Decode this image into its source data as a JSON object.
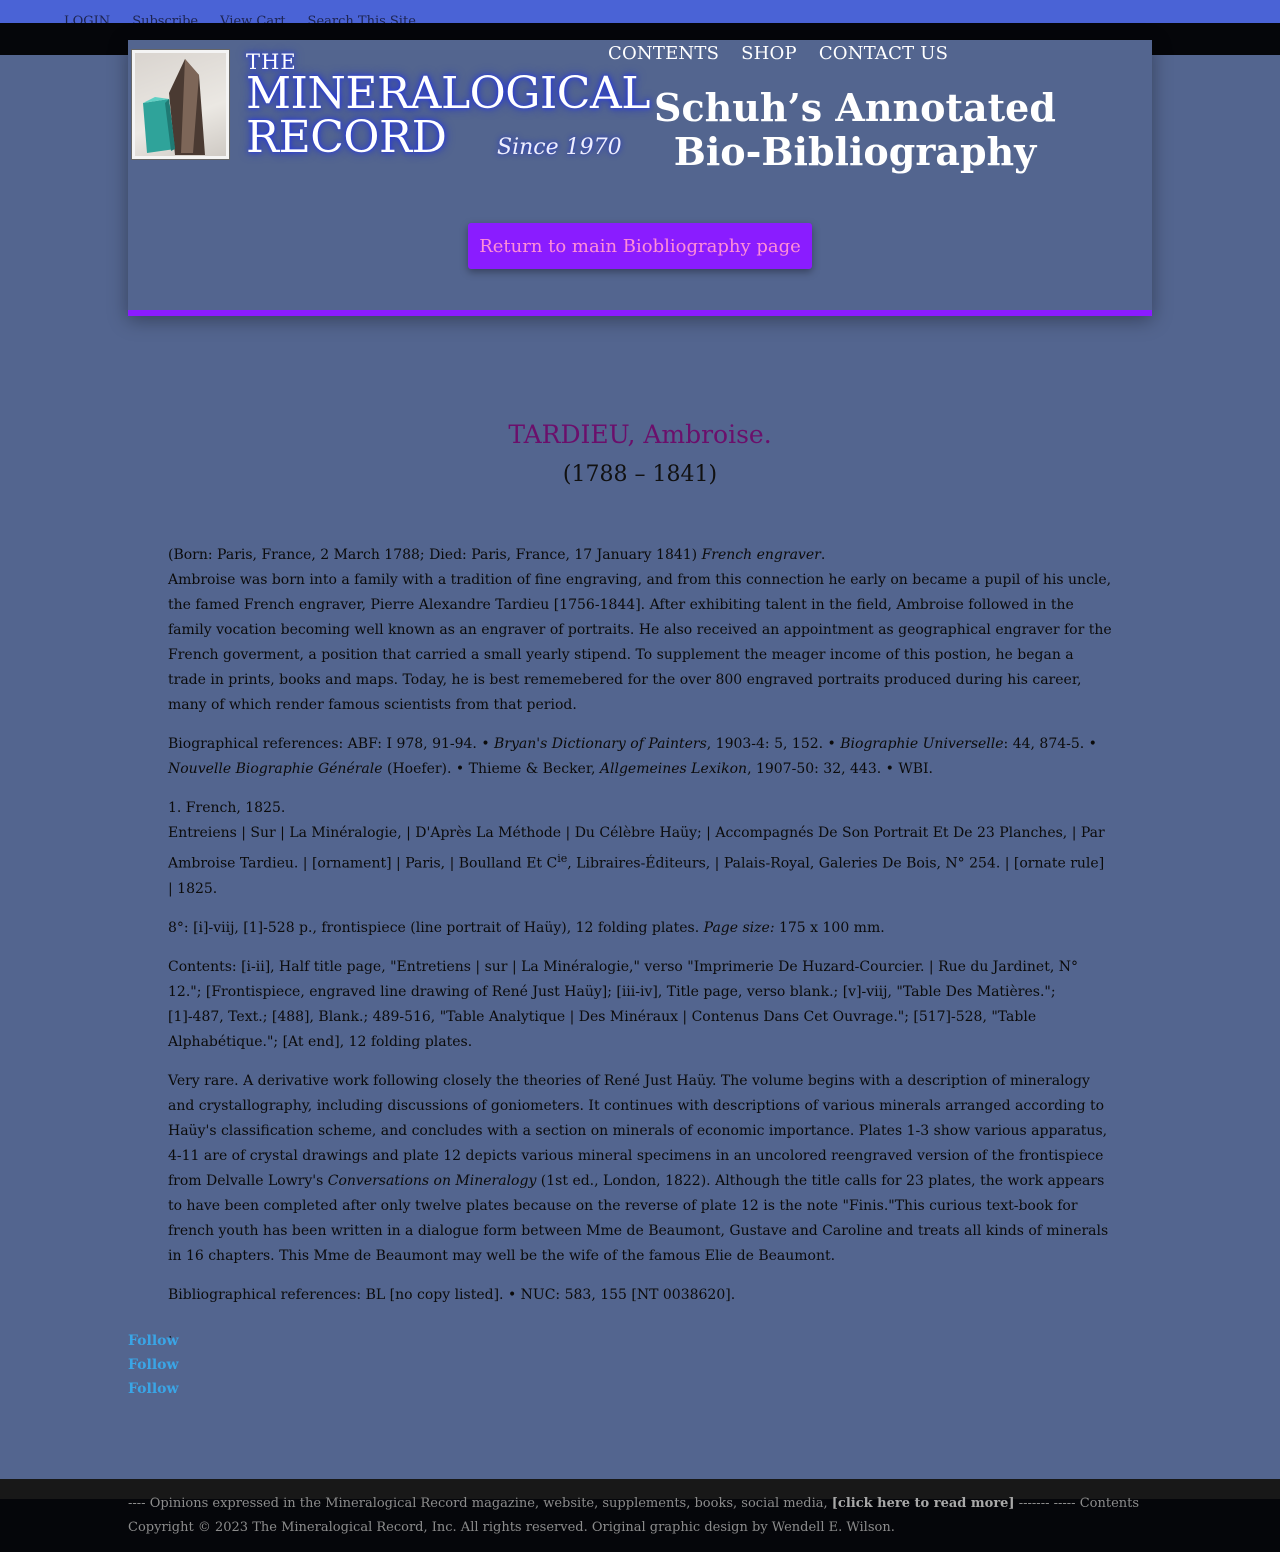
{
  "top_links": [
    "LOGIN",
    "Subscribe",
    "View Cart",
    "Search This Site"
  ],
  "nav": [
    "CONTENTS",
    "SHOP",
    "CONTACT US"
  ],
  "logo": {
    "the": "THE",
    "line1": "MINERALOGICAL",
    "line2": "RECORD",
    "since": "Since 1970"
  },
  "page_title": "Schuh’s Annotated Bio-Bibliography",
  "return_button": "Return to main Biobliography page",
  "entry": {
    "name": "TARDIEU, Ambroise.",
    "dates": "(1788 – 1841)",
    "born_line": "(Born: Paris, France, 2 March 1788; Died: Paris, France, 17 January 1841)",
    "occupation": "French engraver",
    "bio": "Ambroise was born into a family with a tradition of fine engraving, and from this connection he early on became a pupil of his uncle, the famed French engraver, Pierre Alexandre Tardieu [1756-1844]. After exhibiting talent in the field, Ambroise followed in the family vocation becoming well known as an engraver of portraits. He also received an appointment as geographical engraver for the French goverment, a position that carried a small yearly stipend. To supplement the meager income of this postion, he began a trade in prints, books and maps. Today, he is best rememebered for the over 800 engraved portraits produced during his career, many of which render famous scientists from that period.",
    "bio_refs": {
      "prefix": "Biographical references: ABF: I 978, 91-94. • ",
      "t1": "Bryan's Dictionary of Painters",
      "s1": ", 1903-4: 5, 152. • ",
      "t2": "Biographie Universelle",
      "s2": ": 44, 874-5. • ",
      "t3": "Nouvelle Biographie Générale",
      "s3": " (Hoefer). • Thieme & Becker, ",
      "t4": "Allgemeines Lexikon",
      "s4": ", 1907-50: 32, 443. • WBI."
    },
    "edition_heading": "1. French, 1825.",
    "title_a": "Entreiens | Sur | La Minéralogie, | D'Après La Méthode | Du Célèbre Haüy; | Accompagnés De Son Portrait Et De 23 Planches, | Par Ambroise Tardieu. | [ornament] | Paris, | Boulland Et C",
    "title_sup": "ie",
    "title_b": ", Libraires-Éditeurs, | Palais-Royal, Galeries De Bois, N° 254. | [ornate rule] | 1825.",
    "collation": "8°: [i]-viij, [1]-528 p., frontispiece (line portrait of Haüy), 12 folding plates. ",
    "page_size_label": "Page size:",
    "page_size": " 175 x 100 mm.",
    "contents": "Contents: [i-ii], Half title page, \"Entretiens | sur | La Minéralogie,\" verso \"Imprimerie De Huzard-Courcier. | Rue du Jardinet, N° 12.\"; [Frontispiece, engraved line drawing of René Just Haüy]; [iii-iv], Title page, verso blank.; [v]-viij, \"Table Des Matières.\"; [1]-487, Text.; [488], Blank.; 489-516, \"Table Analytique | Des Minéraux | Contenus Dans Cet Ouvrage.\"; [517]-528, \"Table Alphabétique.\"; [At end], 12 folding plates.",
    "notes_a": "Very rare. A derivative work following closely the theories of René Just Haüy. The volume begins with a description of mineralogy and crystallography, including discussions of goniometers. It continues with descriptions of various minerals arranged according to Haüy's classification scheme, and concludes with a section on minerals of economic importance. Plates 1-3 show various apparatus, 4-11 are of crystal drawings and plate 12 depicts various mineral specimens in an uncolored reengraved version of the frontispiece from Delvalle Lowry's ",
    "notes_title": "Conversations on Mineralogy",
    "notes_b": " (1st ed., London, 1822). Although the title calls for 23 plates, the work appears to have been completed after only twelve plates because on the reverse of plate 12 is the note \"Finis.\"This curious text-book for french youth has been written in a dialogue form between Mme de Beaumont, Gustave and Caroline and treats all kinds of minerals in 16 chapters. This Mme de Beaumont may well be the wife of the famous Elie de Beaumont.",
    "bibliographical_refs": "Bibliographical references: BL [no copy listed]. • NUC: 583, 155 [NT 0038620].",
    "trailing": "."
  },
  "follow_links": [
    "Follow",
    "Follow",
    "Follow"
  ],
  "footer": {
    "opinions_a": "---- Opinions expressed in the Mineralogical Record magazine, website, supplements, books, social media, ",
    "read_more": "[click here to read more]",
    "opinions_b": " ------- ----- Contents",
    "copyright": "Copyright © 2023 The Mineralogical Record, Inc. All rights reserved. Original graphic design by Wendell E. Wilson."
  },
  "colors": {
    "background": "#53658f",
    "accent": "#8a1cff",
    "top_bar": "#4a63d6",
    "name": "#6b0f6b",
    "follow": "#3aa5e6"
  }
}
